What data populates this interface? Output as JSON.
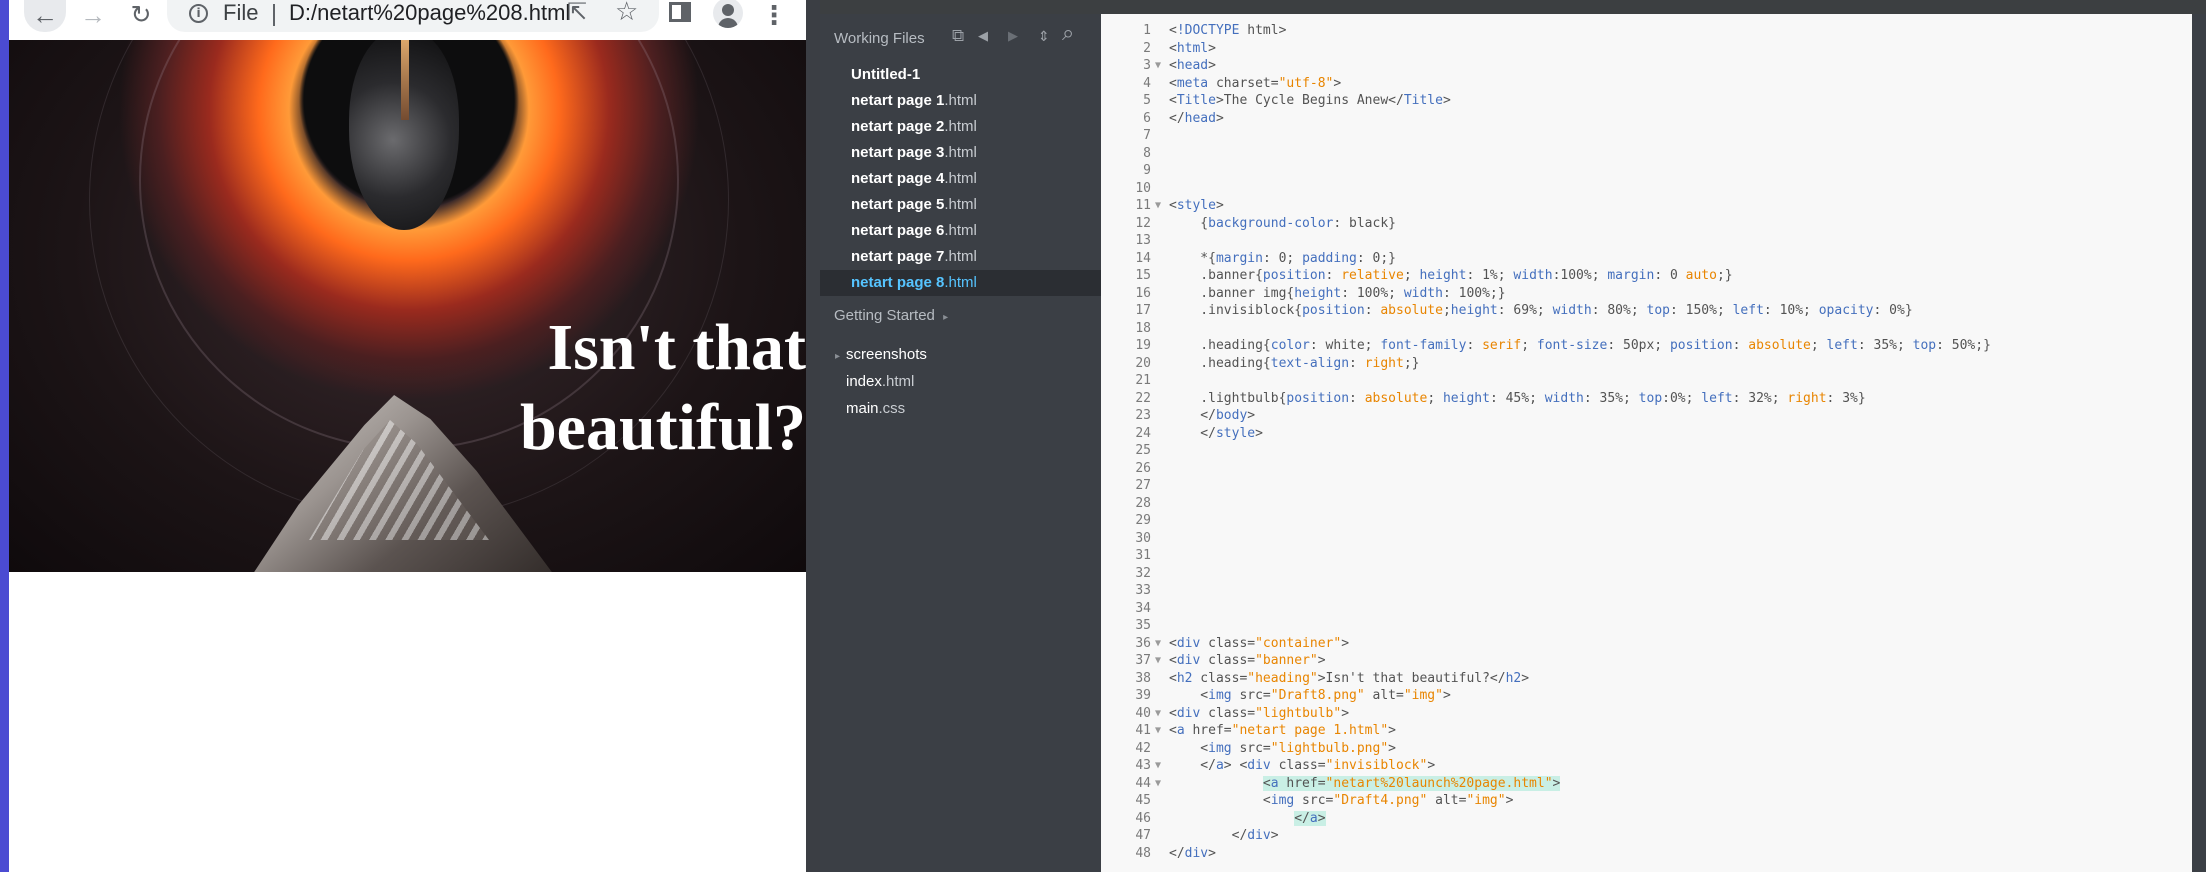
{
  "browser": {
    "scheme": "File",
    "url": "D:/netart%20page%208.html",
    "icons": [
      "back-arrow-icon",
      "forward-arrow-icon",
      "reload-icon",
      "info-icon",
      "share-icon",
      "star-icon",
      "side-panel-icon",
      "profile-icon",
      "menu-icon"
    ],
    "glyphs": {
      "back": "←",
      "forward": "→",
      "reload": "↻",
      "info": "i",
      "share": "⇱",
      "star": "☆",
      "menu": "⋮"
    },
    "page": {
      "heading": "Isn't that beautiful?"
    }
  },
  "sidebar": {
    "working_files_title": "Working Files",
    "working_files": [
      {
        "base": "Untitled-1",
        "ext": ""
      },
      {
        "base": "netart page 1",
        "ext": ".html"
      },
      {
        "base": "netart page 2",
        "ext": ".html"
      },
      {
        "base": "netart page 3",
        "ext": ".html"
      },
      {
        "base": "netart page 4",
        "ext": ".html"
      },
      {
        "base": "netart page 5",
        "ext": ".html"
      },
      {
        "base": "netart page 6",
        "ext": ".html"
      },
      {
        "base": "netart page 7",
        "ext": ".html"
      },
      {
        "base": "netart page 8",
        "ext": ".html"
      }
    ],
    "active_index": 8,
    "getting_started_title": "Getting Started",
    "tree": [
      {
        "base": "screenshots",
        "ext": "",
        "folder": true
      },
      {
        "base": "index",
        "ext": ".html",
        "folder": false
      },
      {
        "base": "main",
        "ext": ".css",
        "folder": false
      }
    ],
    "tool_glyphs": {
      "split": "⧉",
      "prev": "◀",
      "next": "▶",
      "sort": "⇕",
      "search": "⌕",
      "dropdown": "▸",
      "folder_arrow": "▸"
    }
  },
  "code": {
    "highlight_lines": [
      44,
      46
    ],
    "lines": [
      {
        "n": 1,
        "fold": false,
        "text": "<!DOCTYPE html>"
      },
      {
        "n": 2,
        "fold": false,
        "text": "<html>"
      },
      {
        "n": 3,
        "fold": true,
        "text": "<head>"
      },
      {
        "n": 4,
        "fold": false,
        "text": "<meta charset=\"utf-8\">"
      },
      {
        "n": 5,
        "fold": false,
        "text": "<Title>The Cycle Begins Anew</Title>"
      },
      {
        "n": 6,
        "fold": false,
        "text": "</head>"
      },
      {
        "n": 7,
        "fold": false,
        "text": ""
      },
      {
        "n": 8,
        "fold": false,
        "text": ""
      },
      {
        "n": 9,
        "fold": false,
        "text": ""
      },
      {
        "n": 10,
        "fold": false,
        "text": ""
      },
      {
        "n": 11,
        "fold": true,
        "text": "<style>"
      },
      {
        "n": 12,
        "fold": false,
        "text": "    {background-color: black}"
      },
      {
        "n": 13,
        "fold": false,
        "text": ""
      },
      {
        "n": 14,
        "fold": false,
        "text": "    *{margin: 0; padding: 0;}"
      },
      {
        "n": 15,
        "fold": false,
        "text": "    .banner{position: relative; height: 1%; width:100%; margin: 0 auto;}"
      },
      {
        "n": 16,
        "fold": false,
        "text": "    .banner img{height: 100%; width: 100%;}"
      },
      {
        "n": 17,
        "fold": false,
        "text": "    .invisiblock{position: absolute;height: 69%; width: 80%; top: 150%; left: 10%; opacity: 0%}"
      },
      {
        "n": 18,
        "fold": false,
        "text": ""
      },
      {
        "n": 19,
        "fold": false,
        "text": "    .heading{color: white; font-family: serif; font-size: 50px; position: absolute; left: 35%; top: 50%;}"
      },
      {
        "n": 20,
        "fold": false,
        "text": "    .heading{text-align: right;}"
      },
      {
        "n": 21,
        "fold": false,
        "text": ""
      },
      {
        "n": 22,
        "fold": false,
        "text": "    .lightbulb{position: absolute; height: 45%; width: 35%; top:0%; left: 32%; right: 3%}"
      },
      {
        "n": 23,
        "fold": false,
        "text": "    </body>"
      },
      {
        "n": 24,
        "fold": false,
        "text": "    </style>"
      },
      {
        "n": 25,
        "fold": false,
        "text": ""
      },
      {
        "n": 26,
        "fold": false,
        "text": ""
      },
      {
        "n": 27,
        "fold": false,
        "text": ""
      },
      {
        "n": 28,
        "fold": false,
        "text": ""
      },
      {
        "n": 29,
        "fold": false,
        "text": ""
      },
      {
        "n": 30,
        "fold": false,
        "text": ""
      },
      {
        "n": 31,
        "fold": false,
        "text": ""
      },
      {
        "n": 32,
        "fold": false,
        "text": ""
      },
      {
        "n": 33,
        "fold": false,
        "text": ""
      },
      {
        "n": 34,
        "fold": false,
        "text": ""
      },
      {
        "n": 35,
        "fold": false,
        "text": ""
      },
      {
        "n": 36,
        "fold": true,
        "text": "<div class=\"container\">"
      },
      {
        "n": 37,
        "fold": true,
        "text": "<div class=\"banner\">"
      },
      {
        "n": 38,
        "fold": false,
        "text": "<h2 class=\"heading\">Isn't that beautiful?</h2>"
      },
      {
        "n": 39,
        "fold": false,
        "text": "    <img src=\"Draft8.png\" alt=\"img\">"
      },
      {
        "n": 40,
        "fold": true,
        "text": "<div class=\"lightbulb\">"
      },
      {
        "n": 41,
        "fold": true,
        "text": "<a href=\"netart page 1.html\">"
      },
      {
        "n": 42,
        "fold": false,
        "text": "    <img src=\"lightbulb.png\">"
      },
      {
        "n": 43,
        "fold": true,
        "text": "    </a> <div class=\"invisiblock\">"
      },
      {
        "n": 44,
        "fold": true,
        "text": "            <a href=\"netart%20launch%20page.html\">"
      },
      {
        "n": 45,
        "fold": false,
        "text": "            <img src=\"Draft4.png\" alt=\"img\">"
      },
      {
        "n": 46,
        "fold": false,
        "text": "                </a>"
      },
      {
        "n": 47,
        "fold": false,
        "text": "        </div>"
      },
      {
        "n": 48,
        "fold": false,
        "text": "</div>"
      }
    ]
  }
}
